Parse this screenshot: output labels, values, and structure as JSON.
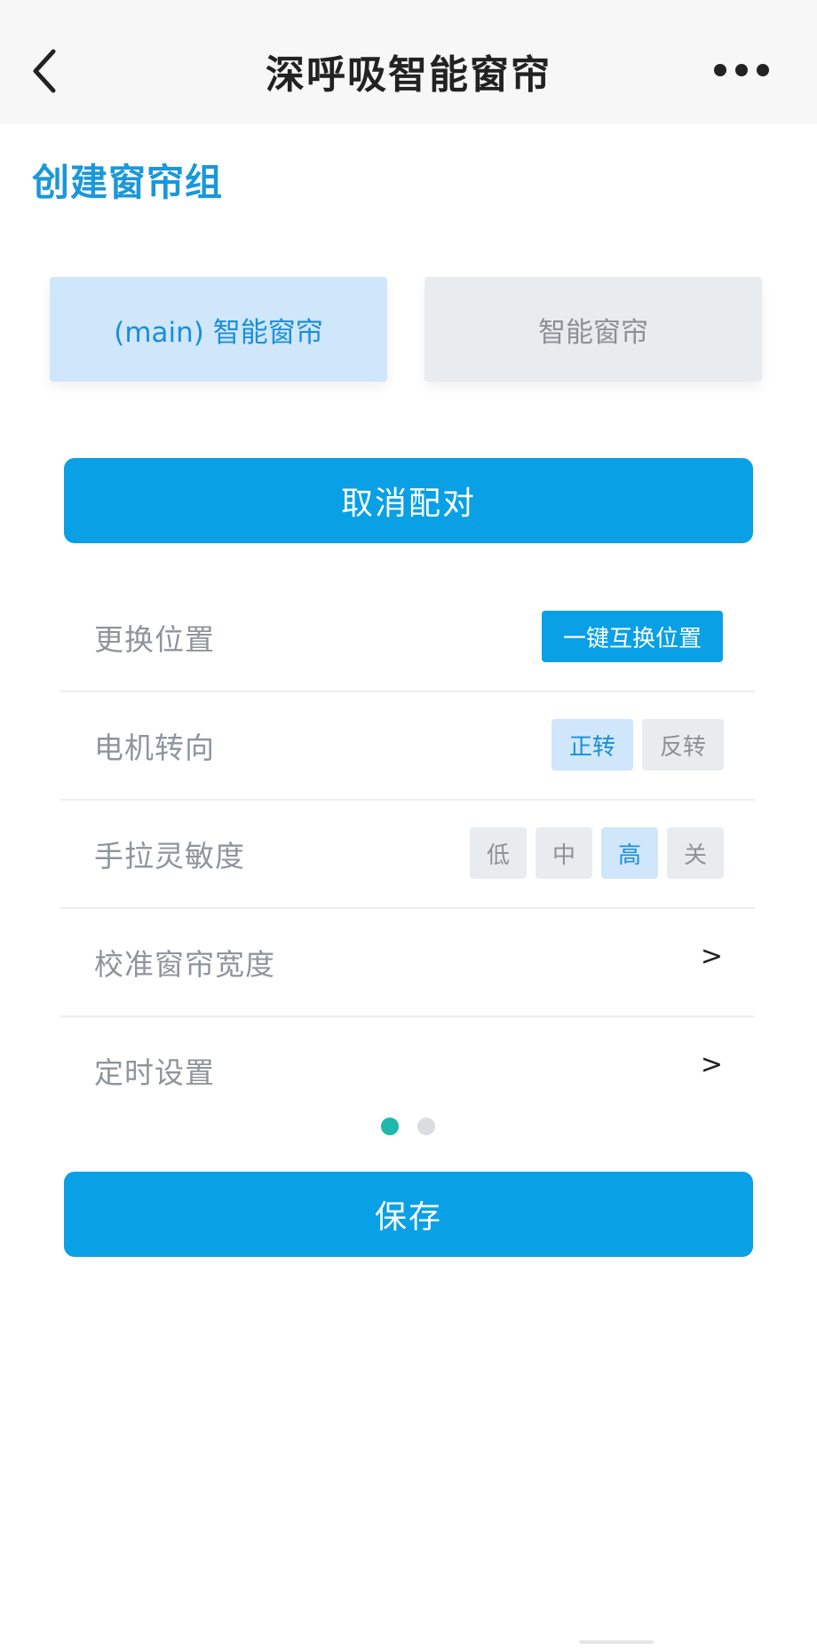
{
  "header": {
    "title": "深呼吸智能窗帘",
    "back_icon": "chevron-left-icon",
    "more_icon": "more-horizontal-icon"
  },
  "page": {
    "title": "创建窗帘组"
  },
  "tabs": [
    {
      "label": "(main) 智能窗帘",
      "selected": true
    },
    {
      "label": "智能窗帘",
      "selected": false
    }
  ],
  "actions": {
    "unpair_label": "取消配对",
    "save_label": "保存"
  },
  "settings": {
    "position": {
      "label": "更换位置",
      "button_label": "一键互换位置"
    },
    "motor_direction": {
      "label": "电机转向",
      "options": [
        {
          "label": "正转",
          "selected": true
        },
        {
          "label": "反转",
          "selected": false
        }
      ]
    },
    "sensitivity": {
      "label": "手拉灵敏度",
      "options": [
        {
          "label": "低",
          "selected": false
        },
        {
          "label": "中",
          "selected": false
        },
        {
          "label": "高",
          "selected": true
        },
        {
          "label": "关",
          "selected": false
        }
      ]
    },
    "calibrate": {
      "label": "校准窗帘宽度",
      "arrow": ">"
    },
    "timer": {
      "label": "定时设置",
      "arrow": ">"
    }
  },
  "pager": {
    "count": 2,
    "active": 1
  },
  "colors": {
    "accent": "#0aa0e6",
    "title_blue": "#1a98d9",
    "selected_bg": "#cfe6fb",
    "unselected_bg": "#e9ecef",
    "active_dot": "#1fb8ad"
  }
}
